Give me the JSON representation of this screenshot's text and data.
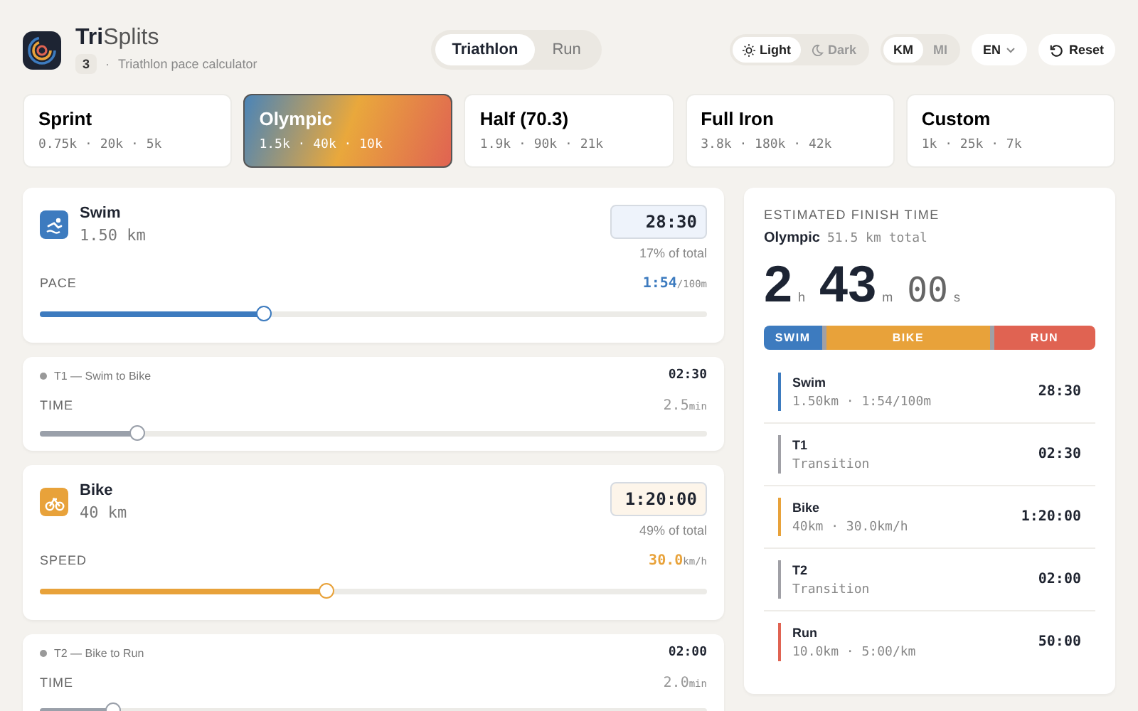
{
  "header": {
    "title_bold": "Tri",
    "title_rest": "Splits",
    "badge": "3",
    "separator": "·",
    "subtitle": "Triathlon pace calculator"
  },
  "mode_tabs": [
    {
      "label": "Triathlon",
      "selected": true
    },
    {
      "label": "Run",
      "selected": false
    }
  ],
  "theme_toggle": [
    {
      "label": "Light",
      "selected": true
    },
    {
      "label": "Dark",
      "selected": false
    }
  ],
  "unit_toggle": [
    {
      "label": "KM",
      "selected": true
    },
    {
      "label": "MI",
      "selected": false
    }
  ],
  "language": {
    "label": "EN"
  },
  "reset": {
    "label": "Reset"
  },
  "presets": [
    {
      "name": "Sprint",
      "distances": "0.75k · 20k · 5k",
      "selected": false
    },
    {
      "name": "Olympic",
      "distances": "1.5k · 40k · 10k",
      "selected": true
    },
    {
      "name": "Half (70.3)",
      "distances": "1.9k · 90k · 21k",
      "selected": false
    },
    {
      "name": "Full Iron",
      "distances": "3.8k · 180k · 42k",
      "selected": false
    },
    {
      "name": "Custom",
      "distances": "1k · 25k · 7k",
      "selected": false
    }
  ],
  "legs": [
    {
      "kind": "sport",
      "name": "Swim",
      "distance": "1.50 km",
      "time": "28:30",
      "share": "17% of total",
      "param": "PACE",
      "value": "1:54",
      "unit": "/100m",
      "level": 0.337,
      "color": "#3d7bbf"
    },
    {
      "kind": "transition",
      "title": "T1 — Swim to Bike",
      "time": "02:30",
      "param": "TIME",
      "value": "2.5",
      "unit": "min",
      "level": 0.147
    },
    {
      "kind": "sport",
      "name": "Bike",
      "distance": "40 km",
      "time": "1:20:00",
      "share": "49% of total",
      "param": "SPEED",
      "value": "30.0",
      "unit": "km/h",
      "level": 0.43,
      "color": "#e8a23a"
    },
    {
      "kind": "transition",
      "title": "T2 — Bike to Run",
      "time": "02:00",
      "param": "TIME",
      "value": "2.0",
      "unit": "min",
      "level": 0.11
    }
  ],
  "summary": {
    "heading": "ESTIMATED FINISH TIME",
    "race": "Olympic",
    "total": "51.5 km total",
    "finish": [
      {
        "value": "2",
        "unit": "h",
        "dim": false
      },
      {
        "value": "43",
        "unit": "m",
        "dim": false
      },
      {
        "value": "00",
        "unit": "s",
        "dim": true
      }
    ],
    "splits": [
      {
        "name": "Swim",
        "bar_label": "SWIM",
        "detail": "1.50km · 1:54/100m",
        "time": "28:30",
        "color": "#3d7bbf"
      },
      {
        "name": "T1",
        "detail": "Transition",
        "time": "02:30",
        "color": "#a0a0a6"
      },
      {
        "name": "Bike",
        "bar_label": "BIKE",
        "detail": "40km · 30.0km/h",
        "time": "1:20:00",
        "color": "#e8a23a"
      },
      {
        "name": "T2",
        "detail": "Transition",
        "time": "02:00",
        "color": "#a0a0a6"
      },
      {
        "name": "Run",
        "bar_label": "RUN",
        "detail": "10.0km · 5:00/km",
        "time": "50:00",
        "color": "#e06352"
      }
    ]
  }
}
